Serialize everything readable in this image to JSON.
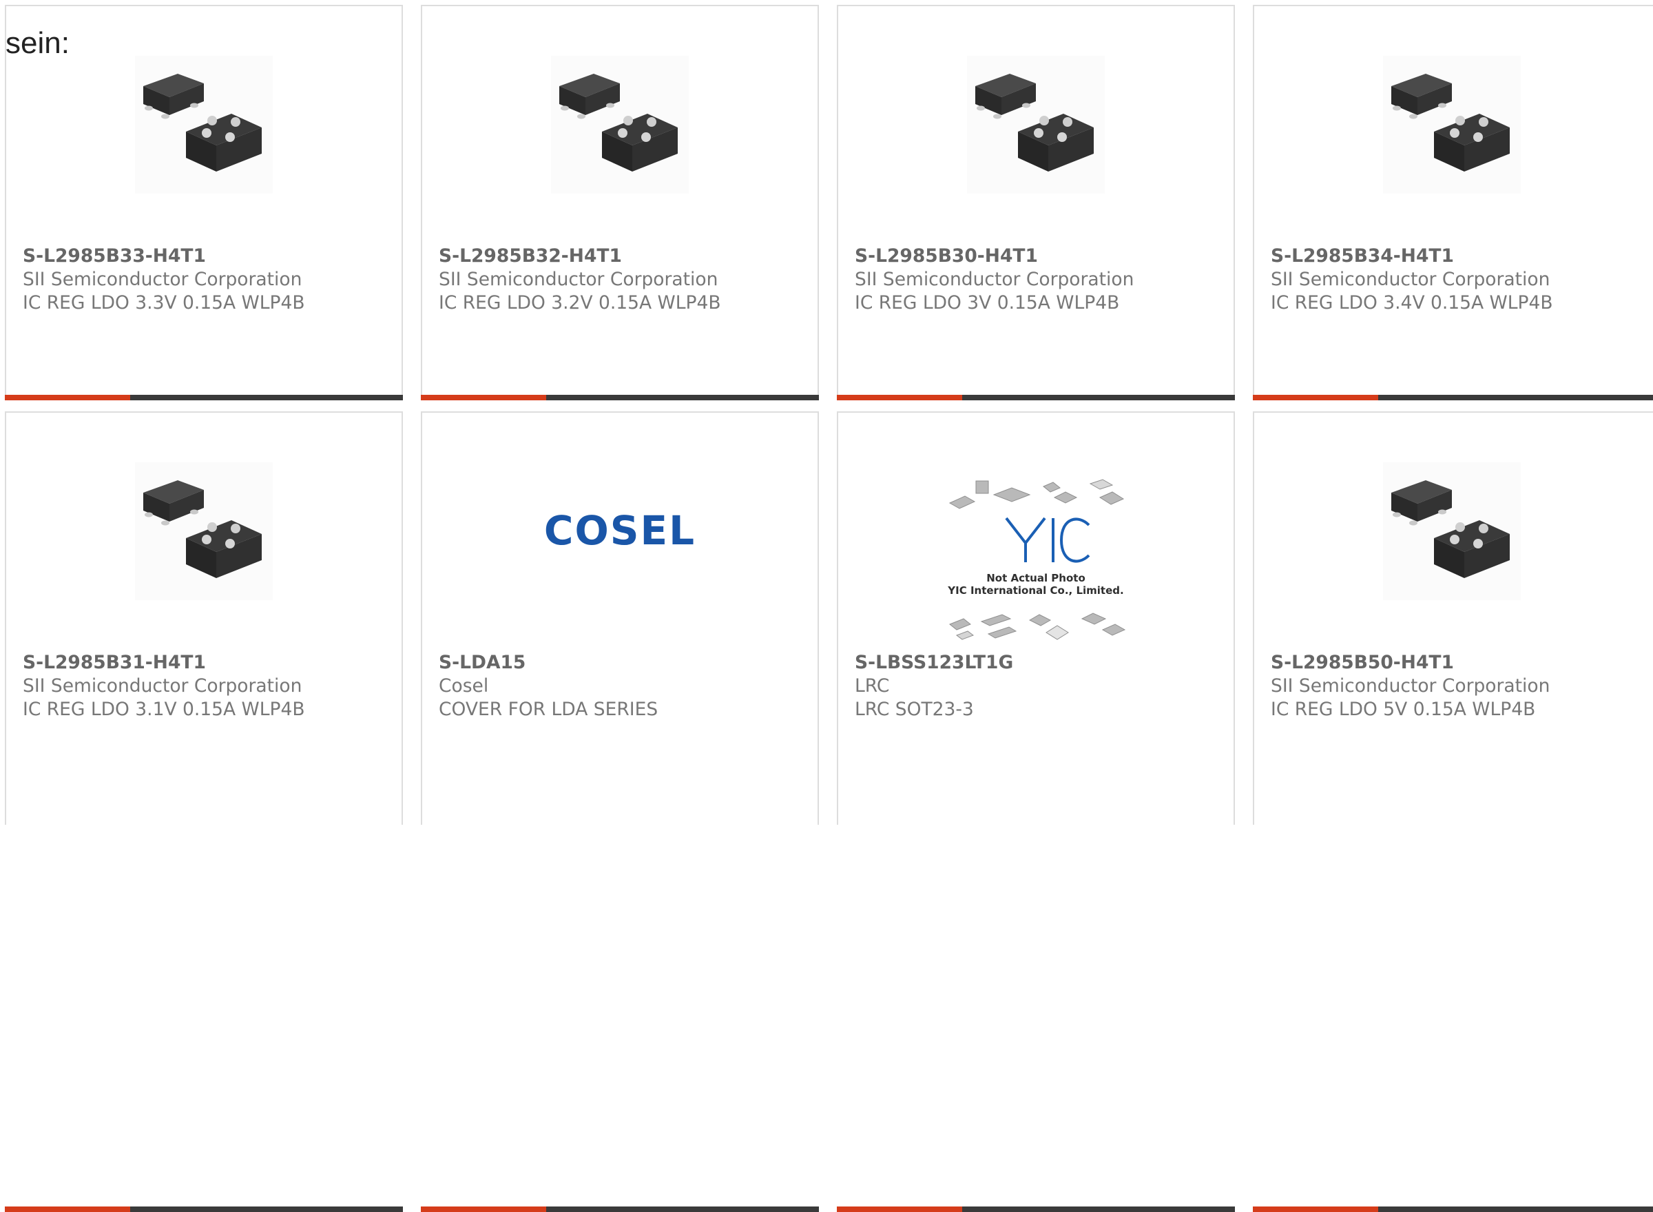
{
  "intro_text": "sein:",
  "colors": {
    "accent": "#d53c1a",
    "bar": "#3a3a3a",
    "text": "#777777",
    "cosel_blue": "#1a56a8"
  },
  "products": [
    {
      "part": "S-L2985B33-H4T1",
      "maker": "SII Semiconductor Corporation",
      "desc": "IC REG LDO 3.3V 0.15A WLP4B",
      "image": "wlp4b-chip-image"
    },
    {
      "part": "S-L2985B32-H4T1",
      "maker": "SII Semiconductor Corporation",
      "desc": "IC REG LDO 3.2V 0.15A WLP4B",
      "image": "wlp4b-chip-image"
    },
    {
      "part": "S-L2985B30-H4T1",
      "maker": "SII Semiconductor Corporation",
      "desc": "IC REG LDO 3V 0.15A WLP4B",
      "image": "wlp4b-chip-image"
    },
    {
      "part": "S-L2985B34-H4T1",
      "maker": "SII Semiconductor Corporation",
      "desc": "IC REG LDO 3.4V 0.15A WLP4B",
      "image": "wlp4b-chip-image"
    },
    {
      "part": "S-L2985B31-H4T1",
      "maker": "SII Semiconductor Corporation",
      "desc": "IC REG LDO 3.1V 0.15A WLP4B",
      "image": "wlp4b-chip-image"
    },
    {
      "part": "S-LDA15",
      "maker": "Cosel",
      "desc": "COVER FOR LDA SERIES",
      "image": "cosel-logo",
      "logo_text": "COSEL"
    },
    {
      "part": "S-LBSS123LT1G",
      "maker": "LRC",
      "desc": "LRC SOT23-3",
      "image": "yic-placeholder-image",
      "placeholder_line1": "Not Actual Photo",
      "placeholder_line2": "YIC International Co., Limited."
    },
    {
      "part": "S-L2985B50-H4T1",
      "maker": "SII Semiconductor Corporation",
      "desc": "IC REG LDO 5V 0.15A WLP4B",
      "image": "wlp4b-chip-image"
    }
  ]
}
